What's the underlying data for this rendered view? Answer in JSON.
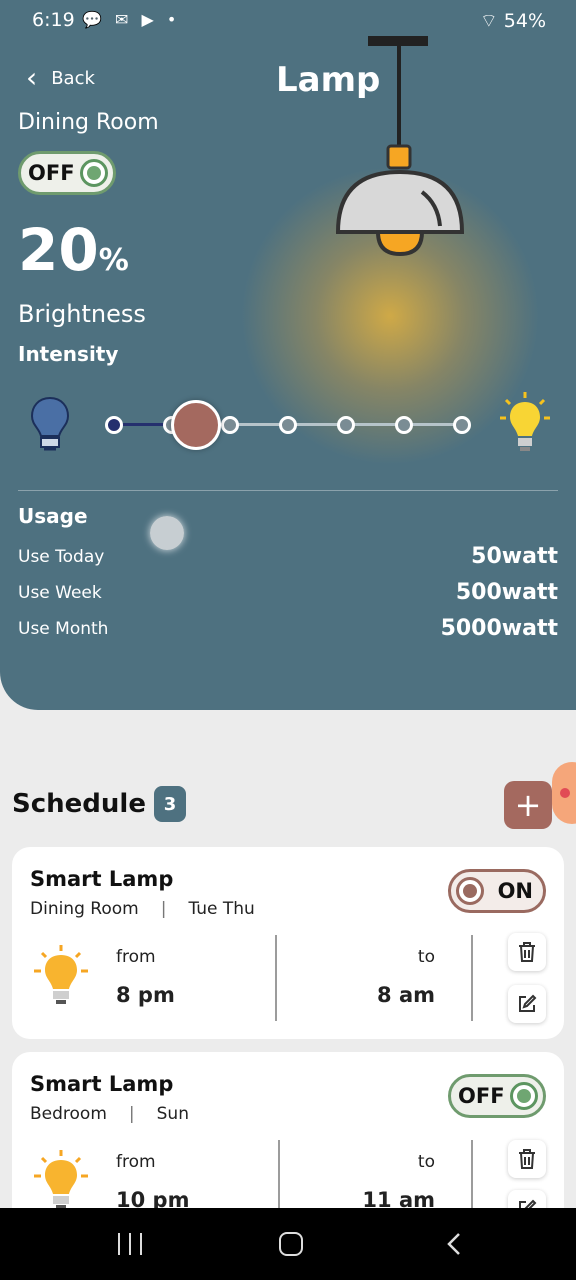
{
  "status": {
    "time": "6:19",
    "left_icons": "💬 ✉ ▶ •",
    "right": "54%",
    "battery_label": "54%"
  },
  "header": {
    "back_label": "Back",
    "title": "Lamp",
    "room": "Dining Room",
    "power": "OFF"
  },
  "brightness": {
    "value": "20",
    "unit": "%",
    "label": "Brightness",
    "intensity_label": "Intensity",
    "level_fraction": 0.2
  },
  "usage": {
    "title": "Usage",
    "rows": [
      {
        "k": "Use Today",
        "v": "50watt"
      },
      {
        "k": "Use Week",
        "v": "500watt"
      },
      {
        "k": "Use Month",
        "v": "5000watt"
      }
    ]
  },
  "schedule": {
    "title": "Schedule",
    "count": "3",
    "add": "+",
    "items": [
      {
        "name": "Smart Lamp",
        "room": "Dining Room",
        "sep": "|",
        "days": "Tue Thu",
        "state": "ON",
        "from_label": "from",
        "from": "8 pm",
        "to_label": "to",
        "to": "8 am"
      },
      {
        "name": "Smart Lamp",
        "room": "Bedroom",
        "sep": "|",
        "days": "Sun",
        "state": "OFF",
        "from_label": "from",
        "from": "10 pm",
        "to_label": "to",
        "to": "11 am"
      }
    ]
  },
  "colors": {
    "primary": "#4e7180",
    "accent": "#a4695f",
    "on_green": "#6f9b6e"
  }
}
